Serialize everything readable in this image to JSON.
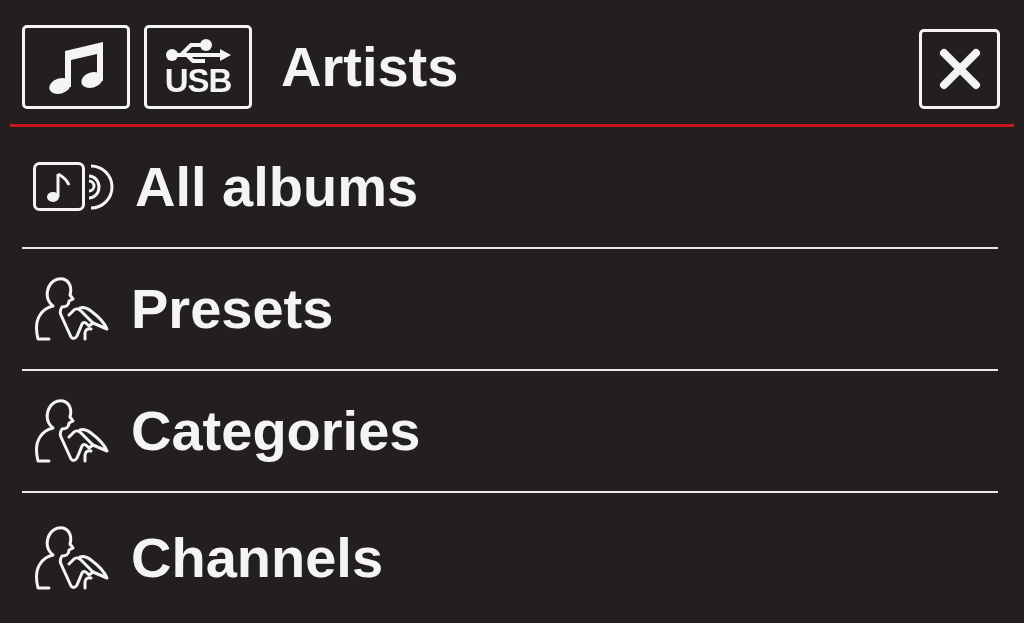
{
  "header": {
    "usb_label": "USB",
    "title": "Artists"
  },
  "menu_items": [
    {
      "kind": "album",
      "label": "All albums"
    },
    {
      "kind": "person",
      "label": "Presets"
    },
    {
      "kind": "person",
      "label": "Categories"
    },
    {
      "kind": "person",
      "label": "Channels"
    }
  ]
}
